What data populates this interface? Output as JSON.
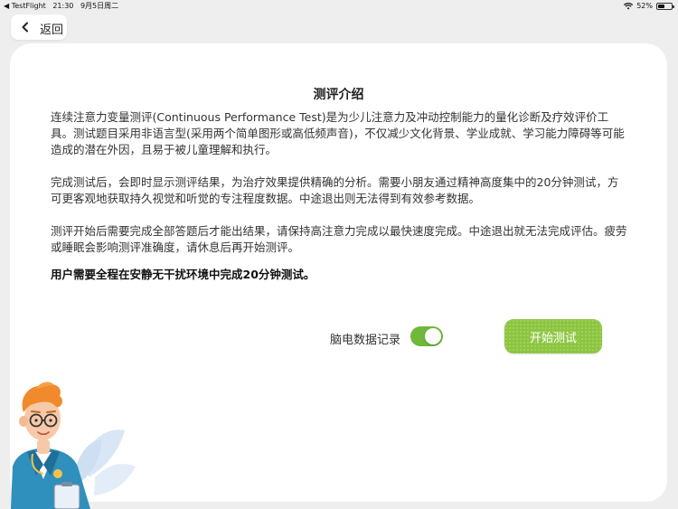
{
  "status_bar": {
    "app_back": "◀ TestFlight",
    "time": "21:30",
    "date": "9月5日周二",
    "battery": "52%",
    "battery_level": 0.52
  },
  "nav": {
    "back_label": "返回"
  },
  "content": {
    "title": "测评介绍",
    "paragraphs": [
      "连续注意力变量测评(Continuous Performance Test)是为少儿注意力及冲动控制能力的量化诊断及疗效评价工具。测试题目采用非语言型(采用两个简单图形或高低频声音)，不仅减少文化背景、学业成就、学习能力障碍等可能造成的潜在外因，且易于被儿童理解和执行。",
      "完成测试后，会即时显示测评结果，为治疗效果提供精确的分析。需要小朋友通过精神高度集中的20分钟测试，方可更客观地获取持久视觉和听觉的专注程度数据。中途退出则无法得到有效参考数据。",
      "测评开始后需要完成全部答题后才能出结果，请保持高注意力完成以最快速度完成。中途退出就无法完成评估。疲劳或睡眠会影响测评准确度，请休息后再开始测评。"
    ],
    "notice": "用户需要全程在安静无干扰环境中完成20分钟测试。"
  },
  "controls": {
    "eeg_label": "脑电数据记录",
    "eeg_enabled": true,
    "start_label": "开始测试"
  },
  "colors": {
    "accent_green": "#8cc63f",
    "toggle_green": "#6fb83a",
    "background": "#eeeeee"
  }
}
